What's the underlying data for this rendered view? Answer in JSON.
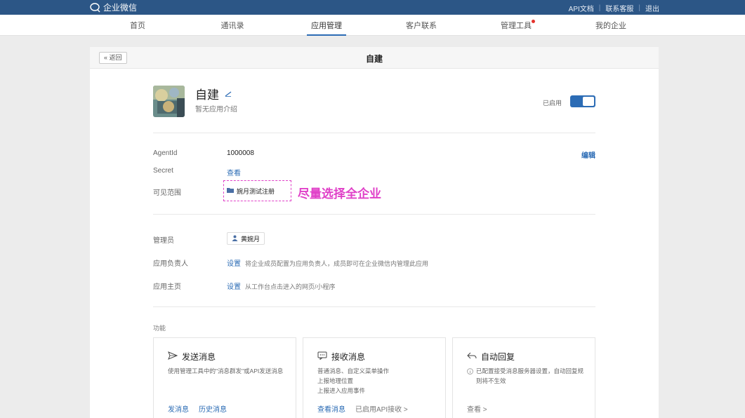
{
  "topbar": {
    "logo_text": "企业微信",
    "links": [
      "API文档",
      "联系客服",
      "退出"
    ],
    "separator": "|",
    "bg_color": "#2c5686"
  },
  "nav": {
    "items": [
      "首页",
      "通讯录",
      "应用管理",
      "客户联系",
      "管理工具",
      "我的企业"
    ],
    "active": "应用管理"
  },
  "panel": {
    "back_label": "« 返回",
    "title": "自建"
  },
  "app": {
    "name": "自建",
    "description": "暂无应用介绍",
    "status_label": "已启用",
    "enabled": true
  },
  "details": {
    "agentid_label": "AgentId",
    "agentid_value": "1000008",
    "edit_label": "编辑",
    "secret_label": "Secret",
    "secret_value": "查看",
    "scope_label": "可见范围",
    "scope_value": "婉月测试注册",
    "annotation": "尽量选择全企业"
  },
  "admin": {
    "admin_label": "管理员",
    "admin_value": "黄婉月",
    "owner_label": "应用负责人",
    "owner_link": "设置",
    "owner_desc": "将企业成员配置为应用负责人，成员即可在企业微信内管理此应用",
    "home_label": "应用主页",
    "home_link": "设置",
    "home_desc": "从工作台点击进入的网页/小程序"
  },
  "features": {
    "section_label": "功能",
    "cards": [
      {
        "title": "发送消息",
        "icon": "send-icon",
        "desc": [
          "使用管理工具中的\"消息群发\"或API发送消息"
        ],
        "links": [
          "发消息",
          "历史消息"
        ]
      },
      {
        "title": "接收消息",
        "icon": "message-icon",
        "desc": [
          "普通消息、自定义菜单操作",
          "上报地理位置",
          "上报进入应用事件"
        ],
        "links": [
          "查看消息",
          "已启用API接收 >"
        ]
      },
      {
        "title": "自动回复",
        "icon": "reply-icon",
        "desc": [
          "已配置接受消息服务器设置，自动回复规则将不生效"
        ],
        "links": [
          "查看 >"
        ]
      }
    ]
  },
  "colors": {
    "accent": "#2c6cb5",
    "annotation": "#e040c8"
  }
}
